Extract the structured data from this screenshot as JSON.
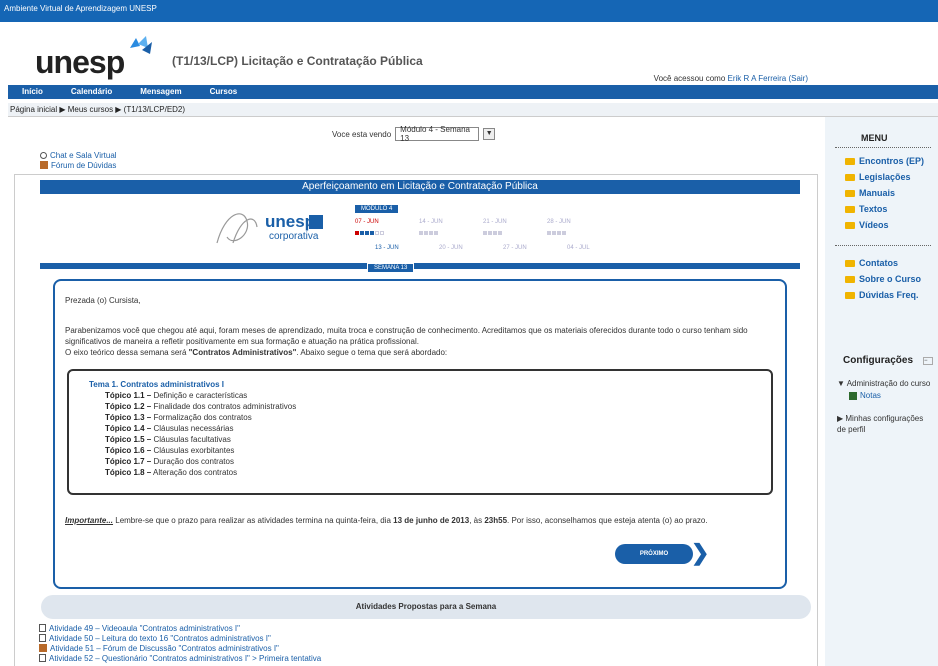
{
  "topbar": {
    "title": "Ambiente Virtual de Aprendizagem UNESP"
  },
  "header": {
    "logo": "unesp",
    "course_title": "(T1/13/LCP) Licitação e Contratação Pública",
    "access_prefix": "Você acessou como",
    "user_name": "Erik R A Ferreira",
    "logout": "(Sair)"
  },
  "nav": {
    "items": [
      "Início",
      "Calendário",
      "Mensagem",
      "Cursos"
    ]
  },
  "breadcrumb": {
    "text": "Página inicial ▶ Meus cursos ▶ (T1/13/LCP/ED2)"
  },
  "selector": {
    "label": "Voce esta vendo",
    "value": "Módulo 4 - Semana 13"
  },
  "left_links": [
    "Chat e Sala Virtual",
    "Fórum de Dúvidas"
  ],
  "banner": {
    "title": "Aperfeiçoamento em Licitação e Contratação Pública",
    "modulo": "MÓDULO 4",
    "corp_main": "unesp",
    "corp_sub": "corporativa",
    "weeks_top": [
      "07 - JUN",
      "14 - JUN",
      "21 - JUN",
      "28 - JUN"
    ],
    "weeks_bottom": [
      "13 - JUN",
      "20 - JUN",
      "27 - JUN",
      "04 - JUL"
    ],
    "semana": "SEMANA 13"
  },
  "content": {
    "greeting": "Prezada (o) Cursista,",
    "para1": "Parabenizamos você que chegou até aqui, foram meses de aprendizado, muita troca e construção de conhecimento. Acreditamos que os materiais oferecidos durante todo o curso tenham sido significativos de maneira a refletir positivamente em sua formação e atuação na prática profissional.",
    "para2_pre": "O eixo teórico dessa semana será ",
    "para2_bold": "\"Contratos Administrativos\"",
    "para2_post": ". Abaixo segue o tema que será abordado:",
    "topic_title": "Tema 1. Contratos administrativos I",
    "topics": [
      {
        "num": "Tópico 1.1 –",
        "text": " Definição e características"
      },
      {
        "num": "Tópico 1.2 –",
        "text": " Finalidade dos contratos administrativos"
      },
      {
        "num": "Tópico 1.3 –",
        "text": " Formalização dos contratos"
      },
      {
        "num": "Tópico 1.4 –",
        "text": " Cláusulas necessárias"
      },
      {
        "num": "Tópico 1.5 –",
        "text": " Cláusulas facultativas"
      },
      {
        "num": "Tópico 1.6 –",
        "text": " Cláusulas exorbitantes"
      },
      {
        "num": "Tópico 1.7 –",
        "text": " Duração dos contratos"
      },
      {
        "num": "Tópico 1.8 –",
        "text": " Alteração dos contratos"
      }
    ],
    "important_label": "Importante...",
    "important_text1": " Lembre-se que o prazo para realizar as atividades termina na quinta-feira, dia ",
    "important_date": "13 de junho de 2013",
    "important_text2": ", às ",
    "important_time": "23h55",
    "important_text3": ". Por isso, aconselhamos que esteja atenta (o) ao prazo.",
    "next_button": "PRÓXIMO"
  },
  "activities": {
    "title": "Atividades Propostas para a Semana",
    "items": [
      "Atividade 49 – Videoaula \"Contratos administrativos I\"",
      "Atividade 50 – Leitura do texto 16 \"Contratos administrativos I\"",
      "Atividade 51 – Fórum de Discussão \"Contratos administrativos I\"",
      "Atividade 52 – Questionário \"Contratos administrativos I\" > Primeira tentativa"
    ]
  },
  "sidebar": {
    "menu_title": "MENU",
    "group1": [
      "Encontros (EP)",
      "Legislações",
      "Manuais",
      "Textos",
      "Vídeos"
    ],
    "group2": [
      "Contatos",
      "Sobre o Curso",
      "Dúvidas Freq."
    ],
    "config_title": "Configurações",
    "admin_course": "Administração do curso",
    "notas": "Notas",
    "profile_settings": "Minhas configurações de perfil"
  },
  "colors": {
    "primary": "#1a5fa8",
    "topbar": "#1566b5",
    "folder": "#f0b400"
  }
}
